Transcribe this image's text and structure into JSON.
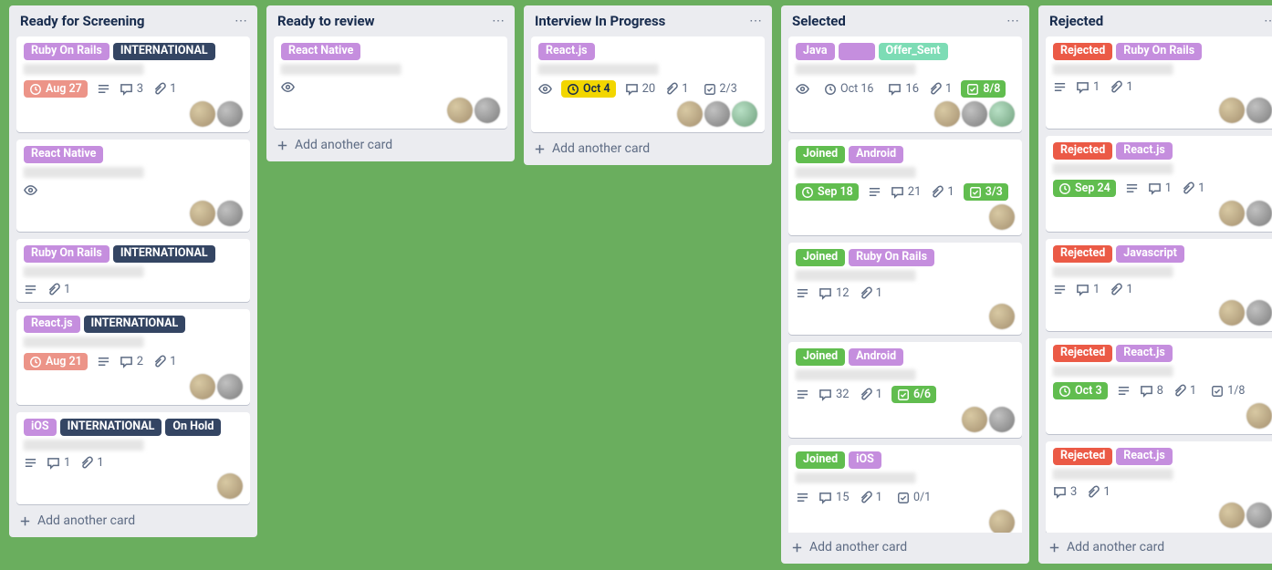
{
  "add_card_label": "Add another card",
  "lists": [
    {
      "title": "Ready for Screening",
      "cards": [
        {
          "labels": [
            {
              "text": "Ruby On Rails",
              "cls": "lbl-purple"
            },
            {
              "text": "INTERNATIONAL",
              "cls": "lbl-black"
            }
          ],
          "due": {
            "text": "Aug 27",
            "cls": ""
          },
          "desc": true,
          "comments": "3",
          "attach": "1",
          "watch": false,
          "check": null,
          "members": 2
        },
        {
          "labels": [
            {
              "text": "React Native",
              "cls": "lbl-purple"
            }
          ],
          "due": null,
          "desc": false,
          "comments": null,
          "attach": null,
          "watch": true,
          "check": null,
          "members": 2
        },
        {
          "labels": [
            {
              "text": "Ruby On Rails",
              "cls": "lbl-purple"
            },
            {
              "text": "INTERNATIONAL",
              "cls": "lbl-black"
            }
          ],
          "due": null,
          "desc": true,
          "comments": null,
          "attach": "1",
          "watch": false,
          "check": null,
          "members": 0
        },
        {
          "labels": [
            {
              "text": "React.js",
              "cls": "lbl-purple"
            },
            {
              "text": "INTERNATIONAL",
              "cls": "lbl-black"
            }
          ],
          "due": {
            "text": "Aug 21",
            "cls": ""
          },
          "desc": true,
          "comments": "2",
          "attach": "1",
          "watch": false,
          "check": null,
          "members": 2
        },
        {
          "labels": [
            {
              "text": "iOS",
              "cls": "lbl-purple"
            },
            {
              "text": "INTERNATIONAL",
              "cls": "lbl-black"
            },
            {
              "text": "On Hold",
              "cls": "lbl-black"
            }
          ],
          "due": null,
          "desc": true,
          "comments": "1",
          "attach": "1",
          "watch": false,
          "check": null,
          "members": 1
        }
      ]
    },
    {
      "title": "Ready to review",
      "cards": [
        {
          "labels": [
            {
              "text": "React Native",
              "cls": "lbl-purple"
            }
          ],
          "due": null,
          "desc": false,
          "comments": null,
          "attach": null,
          "watch": true,
          "check": null,
          "members": 2
        }
      ]
    },
    {
      "title": "Interview In Progress",
      "cards": [
        {
          "labels": [
            {
              "text": "React.js",
              "cls": "lbl-purple"
            }
          ],
          "due": {
            "text": "Oct 4",
            "cls": "yellow"
          },
          "desc": false,
          "comments": "20",
          "attach": "1",
          "watch": true,
          "check": {
            "text": "2/3",
            "cls": "plain"
          },
          "members": 3
        }
      ]
    },
    {
      "title": "Selected",
      "cards": [
        {
          "labels": [
            {
              "text": "Java",
              "cls": "lbl-purple"
            },
            {
              "text": "",
              "cls": "lbl-space"
            },
            {
              "text": "Offer_Sent",
              "cls": "lbl-mint"
            }
          ],
          "due": {
            "text": "Oct 16",
            "cls": "plain"
          },
          "desc": false,
          "comments": "16",
          "attach": "1",
          "watch": true,
          "check": {
            "text": "8/8",
            "cls": "green"
          },
          "members": 3
        },
        {
          "labels": [
            {
              "text": "Joined",
              "cls": "lbl-green"
            },
            {
              "text": "Android",
              "cls": "lbl-purple"
            }
          ],
          "due": {
            "text": "Sep 18",
            "cls": "green"
          },
          "desc": true,
          "comments": "21",
          "attach": "1",
          "watch": false,
          "check": {
            "text": "3/3",
            "cls": "green"
          },
          "members": 1
        },
        {
          "labels": [
            {
              "text": "Joined",
              "cls": "lbl-green"
            },
            {
              "text": "Ruby On Rails",
              "cls": "lbl-purple"
            }
          ],
          "due": null,
          "desc": true,
          "comments": "12",
          "attach": "1",
          "watch": false,
          "check": null,
          "members": 1
        },
        {
          "labels": [
            {
              "text": "Joined",
              "cls": "lbl-green"
            },
            {
              "text": "Android",
              "cls": "lbl-purple"
            }
          ],
          "due": null,
          "desc": true,
          "comments": "32",
          "attach": "1",
          "watch": false,
          "check": {
            "text": "6/6",
            "cls": "green"
          },
          "members": 2
        },
        {
          "labels": [
            {
              "text": "Joined",
              "cls": "lbl-green"
            },
            {
              "text": "iOS",
              "cls": "lbl-purple"
            }
          ],
          "due": null,
          "desc": true,
          "comments": "15",
          "attach": "1",
          "watch": false,
          "check": {
            "text": "0/1",
            "cls": "plain"
          },
          "members": 1
        }
      ]
    },
    {
      "title": "Rejected",
      "cards": [
        {
          "labels": [
            {
              "text": "Rejected",
              "cls": "lbl-red"
            },
            {
              "text": "Ruby On Rails",
              "cls": "lbl-purple"
            }
          ],
          "due": null,
          "desc": true,
          "comments": "1",
          "attach": "1",
          "watch": false,
          "check": null,
          "members": 2
        },
        {
          "labels": [
            {
              "text": "Rejected",
              "cls": "lbl-red"
            },
            {
              "text": "React.js",
              "cls": "lbl-purple"
            }
          ],
          "due": {
            "text": "Sep 24",
            "cls": "green"
          },
          "desc": true,
          "comments": "1",
          "attach": "1",
          "watch": false,
          "check": null,
          "members": 2
        },
        {
          "labels": [
            {
              "text": "Rejected",
              "cls": "lbl-red"
            },
            {
              "text": "Javascript",
              "cls": "lbl-purple"
            }
          ],
          "due": null,
          "desc": true,
          "comments": "1",
          "attach": "1",
          "watch": false,
          "check": null,
          "members": 2
        },
        {
          "labels": [
            {
              "text": "Rejected",
              "cls": "lbl-red"
            },
            {
              "text": "React.js",
              "cls": "lbl-purple"
            }
          ],
          "due": {
            "text": "Oct 3",
            "cls": "green"
          },
          "desc": true,
          "comments": "8",
          "attach": "1",
          "watch": false,
          "check": {
            "text": "1/8",
            "cls": "plain"
          },
          "members": 1
        },
        {
          "labels": [
            {
              "text": "Rejected",
              "cls": "lbl-red"
            },
            {
              "text": "React.js",
              "cls": "lbl-purple"
            }
          ],
          "due": null,
          "desc": false,
          "comments": "3",
          "attach": "1",
          "watch": false,
          "check": null,
          "members": 2
        }
      ]
    }
  ]
}
